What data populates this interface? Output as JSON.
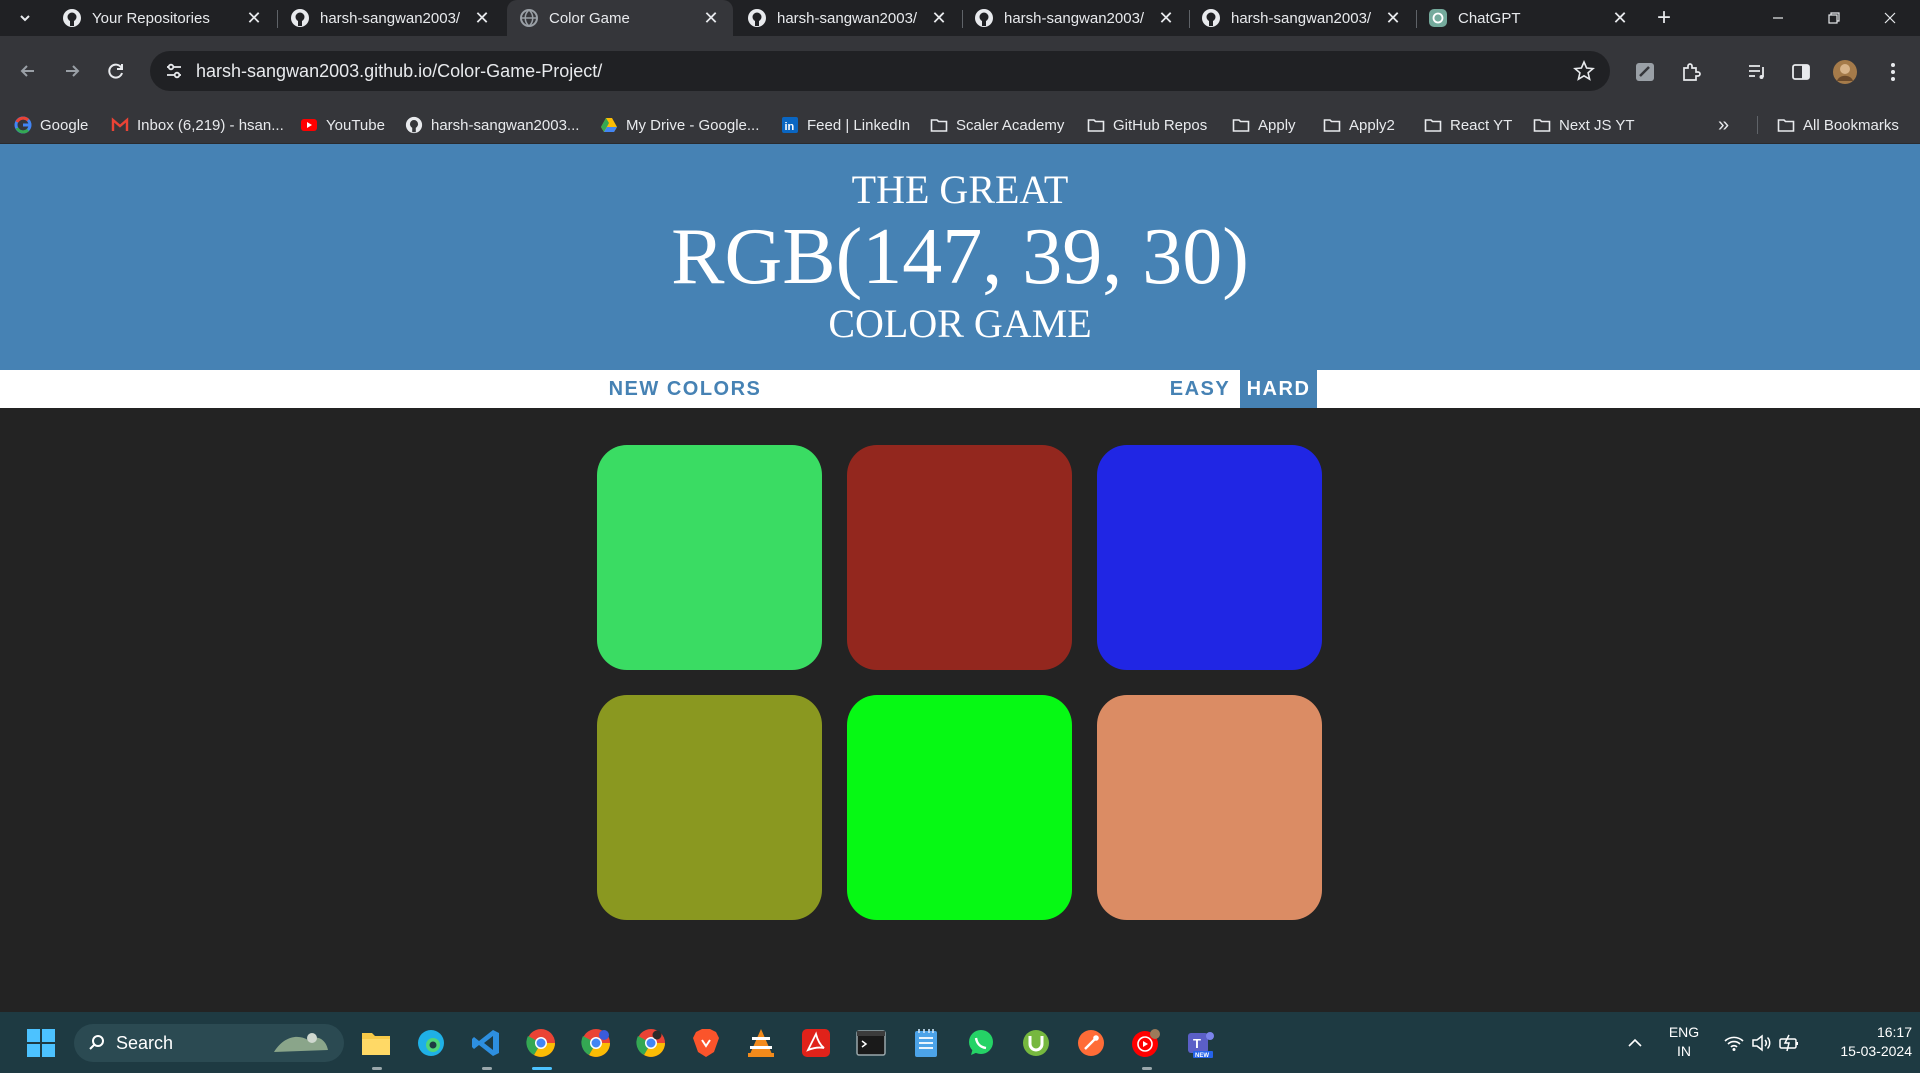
{
  "browser": {
    "tabs": [
      {
        "title": "Your Repositories",
        "icon": "github-icon",
        "active": false
      },
      {
        "title": "harsh-sangwan2003/",
        "icon": "github-icon",
        "active": false
      },
      {
        "title": "Color Game",
        "icon": "globe-icon",
        "active": true
      },
      {
        "title": "harsh-sangwan2003/",
        "icon": "github-icon",
        "active": false
      },
      {
        "title": "harsh-sangwan2003/",
        "icon": "github-icon",
        "active": false
      },
      {
        "title": "harsh-sangwan2003/",
        "icon": "github-icon",
        "active": false
      },
      {
        "title": "ChatGPT",
        "icon": "chatgpt-icon",
        "active": false
      }
    ],
    "url": "harsh-sangwan2003.github.io/Color-Game-Project/",
    "bookmarks": [
      {
        "label": "Google",
        "icon": "google-icon"
      },
      {
        "label": "Inbox (6,219) - hsan...",
        "icon": "gmail-icon"
      },
      {
        "label": "YouTube",
        "icon": "youtube-icon"
      },
      {
        "label": "harsh-sangwan2003...",
        "icon": "github-icon"
      },
      {
        "label": "My Drive - Google...",
        "icon": "google-drive-icon"
      },
      {
        "label": "Feed | LinkedIn",
        "icon": "linkedin-icon"
      },
      {
        "label": "Scaler Academy",
        "icon": "folder-icon"
      },
      {
        "label": "GitHub Repos",
        "icon": "folder-icon"
      },
      {
        "label": "Apply",
        "icon": "folder-icon"
      },
      {
        "label": "Apply2",
        "icon": "folder-icon"
      },
      {
        "label": "React YT",
        "icon": "folder-icon"
      },
      {
        "label": "Next JS YT",
        "icon": "folder-icon"
      }
    ],
    "all_bookmarks": "All Bookmarks"
  },
  "game": {
    "title_top": "THE GREAT",
    "target_rgb": "RGB(147, 39, 30)",
    "title_bottom": "COLOR GAME",
    "new_colors_label": "NEW COLORS",
    "easy_label": "EASY",
    "hard_label": "HARD",
    "selected_mode": "HARD",
    "squares": [
      "#3adc63",
      "#93271e",
      "#2026e4",
      "#8a9820",
      "#06f914",
      "#db8c64"
    ]
  },
  "taskbar": {
    "search_label": "Search",
    "lang_top": "ENG",
    "lang_bottom": "IN",
    "time": "16:17",
    "date": "15-03-2024"
  }
}
